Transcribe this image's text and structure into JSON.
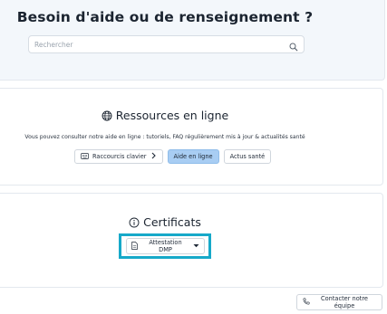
{
  "hero": {
    "title": "Besoin d'aide ou de renseignement ?",
    "search_placeholder": "Rechercher",
    "search_icon": "search-icon"
  },
  "resources": {
    "icon": "globe-icon",
    "title": "Ressources en ligne",
    "description": "Vous pouvez consulter notre aide en ligne : tutoriels, FAQ régulièrement mis à jour & actualités santé",
    "buttons": [
      {
        "label": "Raccourcis clavier",
        "icon": "keyboard-icon",
        "trailing_icon": "chevron-right-icon"
      },
      {
        "label": "Aide en ligne",
        "active": true
      },
      {
        "label": "Actus santé"
      }
    ]
  },
  "certificates": {
    "icon": "info-icon",
    "title": "Certificats",
    "select": {
      "label": "Attestation DMP",
      "icon": "document-icon",
      "caret_icon": "caret-down-icon"
    }
  },
  "footer": {
    "contact_label": "Contacter notre équipe",
    "contact_icon": "phone-icon"
  },
  "colors": {
    "hero_bg": "#f3f7fb",
    "primary_button": "#a8cdf3",
    "highlight": "#16a9c9"
  }
}
